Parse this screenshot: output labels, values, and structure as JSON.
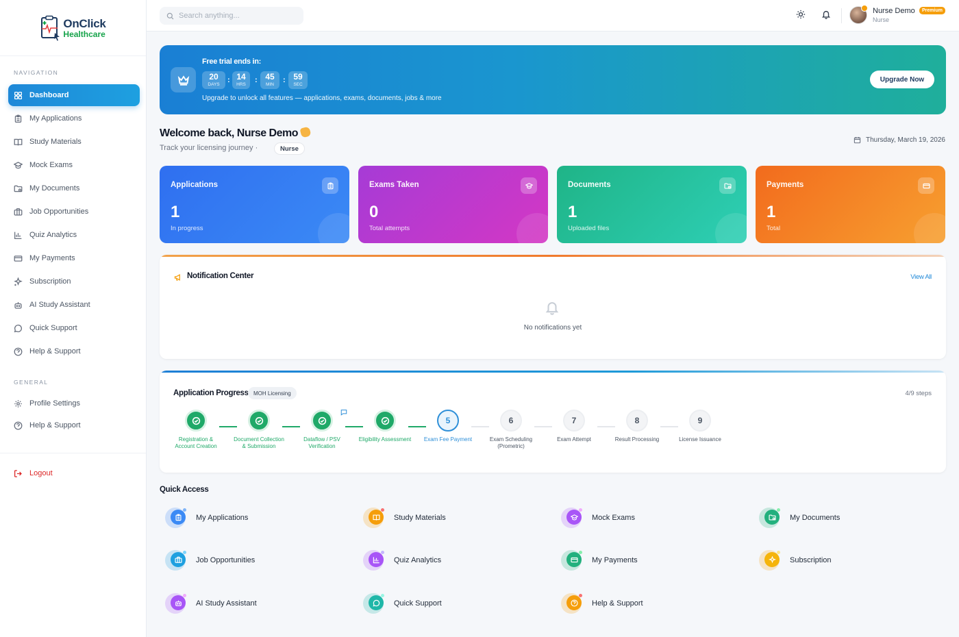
{
  "brand": {
    "line1": "OnClick",
    "line2": "Healthcare"
  },
  "sidebar": {
    "nav_heading": "NAVIGATION",
    "general_heading": "GENERAL",
    "items": [
      {
        "label": "Dashboard",
        "icon": "grid-icon"
      },
      {
        "label": "My Applications",
        "icon": "clipboard-icon"
      },
      {
        "label": "Study Materials",
        "icon": "book-icon"
      },
      {
        "label": "Mock Exams",
        "icon": "graduation-cap-icon"
      },
      {
        "label": "My Documents",
        "icon": "folder-icon"
      },
      {
        "label": "Job Opportunities",
        "icon": "briefcase-icon"
      },
      {
        "label": "Quiz Analytics",
        "icon": "bar-chart-icon"
      },
      {
        "label": "My Payments",
        "icon": "card-icon"
      },
      {
        "label": "Subscription",
        "icon": "sparkle-icon"
      },
      {
        "label": "AI Study Assistant",
        "icon": "robot-icon"
      },
      {
        "label": "Quick Support",
        "icon": "chat-icon"
      },
      {
        "label": "Help & Support",
        "icon": "help-icon"
      }
    ],
    "general": [
      {
        "label": "Profile Settings",
        "icon": "gear-icon"
      },
      {
        "label": "Help & Support",
        "icon": "help-icon"
      }
    ],
    "logout": "Logout"
  },
  "header": {
    "search_placeholder": "Search anything...",
    "user_name": "Nurse Demo",
    "user_role": "Nurse",
    "badge": "Premium"
  },
  "banner": {
    "label": "Free trial ends in:",
    "countdown": [
      {
        "value": "20",
        "unit": "DAYS"
      },
      {
        "value": "14",
        "unit": "HRS"
      },
      {
        "value": "45",
        "unit": "MIN"
      },
      {
        "value": "59",
        "unit": "SEC"
      }
    ],
    "subtitle": "Upgrade to unlock all features — applications, exams, documents, jobs & more",
    "button": "Upgrade Now"
  },
  "welcome": {
    "title": "Welcome back, Nurse Demo",
    "subtitle": "Track your licensing journey ·",
    "role_chip": "Nurse",
    "date": "Thursday, March 19, 2026"
  },
  "stats": [
    {
      "title": "Applications",
      "value": "1",
      "sub": "In progress",
      "icon": "clipboard-icon"
    },
    {
      "title": "Exams Taken",
      "value": "0",
      "sub": "Total attempts",
      "icon": "graduation-cap-icon"
    },
    {
      "title": "Documents",
      "value": "1",
      "sub": "Uploaded files",
      "icon": "folder-icon"
    },
    {
      "title": "Payments",
      "value": "1",
      "sub": "Total",
      "icon": "card-icon"
    }
  ],
  "notifications": {
    "title": "Notification Center",
    "view_all": "View All",
    "empty": "No notifications yet"
  },
  "progress": {
    "title": "Application Progress",
    "chip": "MOH Licensing",
    "count": "4/9 steps",
    "steps": [
      {
        "num": "1",
        "label": "Registration & Account Creation",
        "state": "done"
      },
      {
        "num": "2",
        "label": "Document Collection & Submission",
        "state": "done"
      },
      {
        "num": "3",
        "label": "Dataflow / PSV Verification",
        "state": "done"
      },
      {
        "num": "4",
        "label": "Eligibility Assessment",
        "state": "done"
      },
      {
        "num": "5",
        "label": "Exam Fee Payment",
        "state": "current"
      },
      {
        "num": "6",
        "label": "Exam Scheduling (Prometric)",
        "state": "todo"
      },
      {
        "num": "7",
        "label": "Exam Attempt",
        "state": "todo"
      },
      {
        "num": "8",
        "label": "Result Processing",
        "state": "todo"
      },
      {
        "num": "9",
        "label": "License Issuance",
        "state": "todo"
      }
    ]
  },
  "quick_access": {
    "title": "Quick Access",
    "items": [
      {
        "label": "My Applications",
        "icon": "clipboard-icon",
        "color": "#3b8af5"
      },
      {
        "label": "Study Materials",
        "icon": "book-icon",
        "color": "#f59e0b"
      },
      {
        "label": "Mock Exams",
        "icon": "graduation-cap-icon",
        "color": "#a855f7"
      },
      {
        "label": "My Documents",
        "icon": "folder-icon",
        "color": "#22b07d"
      },
      {
        "label": "Job Opportunities",
        "icon": "briefcase-icon",
        "color": "#1ea0e0"
      },
      {
        "label": "Quiz Analytics",
        "icon": "bar-chart-icon",
        "color": "#a855f7"
      },
      {
        "label": "My Payments",
        "icon": "card-icon",
        "color": "#22b07d"
      },
      {
        "label": "Subscription",
        "icon": "sparkle-icon",
        "color": "#f59e0b"
      },
      {
        "label": "AI Study Assistant",
        "icon": "robot-icon",
        "color": "#a855f7"
      },
      {
        "label": "Quick Support",
        "icon": "chat-icon",
        "color": "#1fb7a8"
      },
      {
        "label": "Help & Support",
        "icon": "help-icon",
        "color": "#f59e0b"
      }
    ]
  }
}
